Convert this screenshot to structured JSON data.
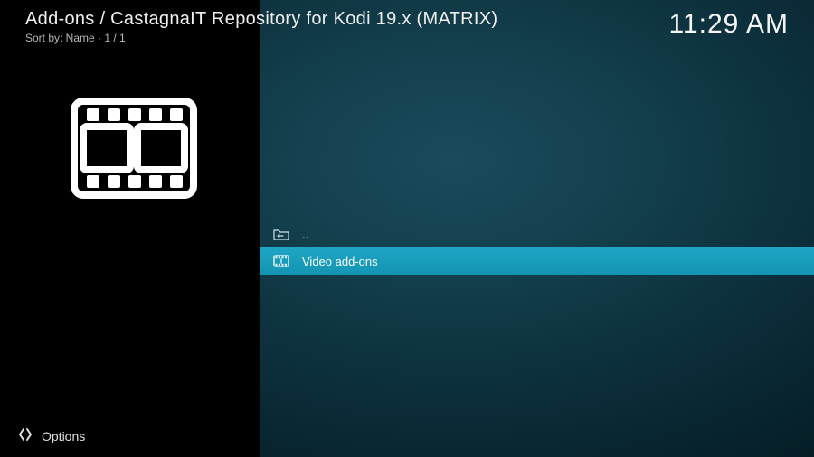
{
  "header": {
    "breadcrumb": "Add-ons / CastagnaIT Repository for Kodi 19.x (MATRIX)",
    "sort_label": "Sort by: Name  ·  1 / 1",
    "clock": "11:29 AM"
  },
  "sidebar": {
    "options_label": "Options"
  },
  "list": {
    "items": [
      {
        "label": "..",
        "icon": "folder-up-icon",
        "selected": false
      },
      {
        "label": "Video add-ons",
        "icon": "film-icon",
        "selected": true
      }
    ]
  }
}
